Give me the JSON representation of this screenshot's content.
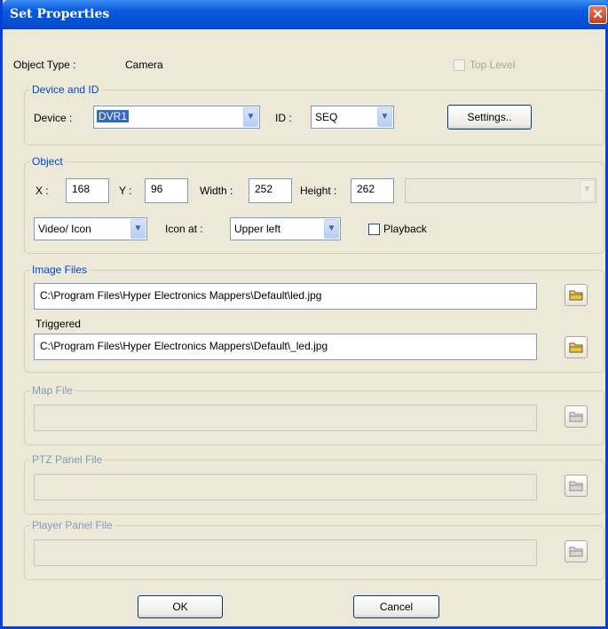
{
  "window": {
    "title": "Set Properties",
    "close_glyph": "✕"
  },
  "header": {
    "object_type_label": "Object Type :",
    "object_type_value": "Camera",
    "top_level_label": "Top Level",
    "top_level_checked": false
  },
  "device_group": {
    "title": "Device and ID",
    "device_label": "Device :",
    "device_value": "DVR1",
    "id_label": "ID :",
    "id_value": "SEQ",
    "settings_label": "Settings.."
  },
  "object_group": {
    "title": "Object",
    "x_label": "X :",
    "x_value": "168",
    "y_label": "Y :",
    "y_value": "96",
    "width_label": "Width :",
    "width_value": "252",
    "height_label": "Height :",
    "height_value": "262",
    "display_value": "Video/ Icon",
    "icon_at_label": "Icon at :",
    "icon_at_value": "Upper left",
    "playback_label": "Playback",
    "playback_checked": false
  },
  "image_files_group": {
    "title": "Image Files",
    "path": "C:\\Program Files\\Hyper Electronics Mappers\\Default\\led.jpg",
    "triggered_label": "Triggered",
    "triggered_path": "C:\\Program Files\\Hyper Electronics Mappers\\Default\\_led.jpg"
  },
  "map_file_group": {
    "title": "Map File",
    "path": ""
  },
  "ptz_panel_group": {
    "title": "PTZ Panel File",
    "path": ""
  },
  "player_panel_group": {
    "title": "Player Panel File",
    "path": ""
  },
  "footer": {
    "ok_label": "OK",
    "cancel_label": "Cancel"
  },
  "icons": {
    "folder": "folder-icon",
    "dropdown": "chevron-down-icon",
    "close": "close-icon"
  },
  "colors": {
    "titlebar": "#0552D6",
    "dialog_bg": "#ECE9D8",
    "group_title": "#0046D5",
    "close_button": "#C4401F"
  }
}
